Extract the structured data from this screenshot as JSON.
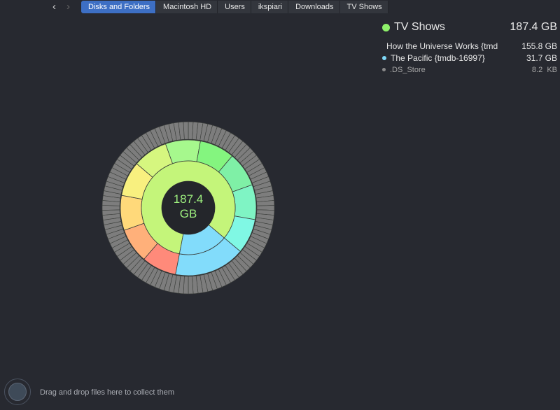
{
  "window": {
    "traffic_lights": {
      "close": "#fe5f57",
      "minimize": "#febc2e",
      "zoom": "#28c840"
    }
  },
  "nav": {
    "back": "‹",
    "forward": "›"
  },
  "breadcrumb": [
    "Disks and Folders",
    "Macintosh HD",
    "Users",
    "ikspiari",
    "Downloads",
    "TV Shows"
  ],
  "summary": {
    "title": "TV Shows",
    "size": "187.4 GB",
    "color": "#8ef06a",
    "items": [
      {
        "name": "How the Universe Works {tmdb",
        "size": "155.8 GB",
        "color": "#c4f57a"
      },
      {
        "name": "The Pacific {tmdb-16997}",
        "size": "31.7 GB",
        "color": "#7fd8f7"
      },
      {
        "name": ".DS_Store",
        "size": "8.2  KB",
        "color": "#8a8a8a"
      }
    ]
  },
  "center": {
    "value": "187.4",
    "unit": "GB"
  },
  "sunburst": {
    "inner": [
      {
        "name": "How the Universe Works",
        "gb": 155.8,
        "color": "#c4f57a"
      },
      {
        "name": "The Pacific",
        "gb": 31.7,
        "color": "#82dcfb"
      }
    ],
    "ring2_colors": [
      "#a6f88d",
      "#84f57f",
      "#7ff0a6",
      "#7ff4c4",
      "#80f8e4",
      "#ff8a7a",
      "#ffb07a",
      "#ffd97a",
      "#f8f07f",
      "#d6f67f"
    ],
    "outer_color": "#7d7d7d"
  },
  "dropzone": {
    "text": "Drag and drop files here to collect them"
  }
}
